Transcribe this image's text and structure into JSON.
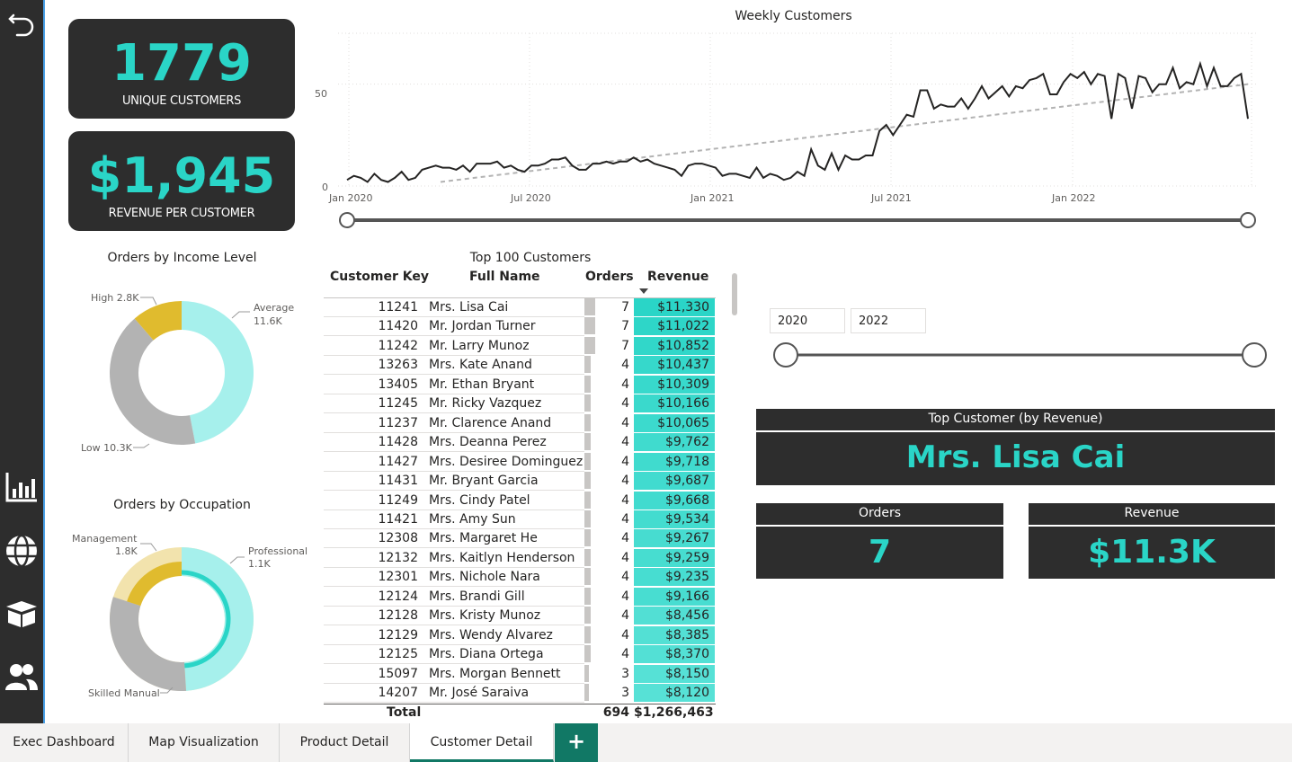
{
  "sidebar": {
    "back_icon": "undo-arrow-icon",
    "items": [
      {
        "icon": "bar-chart-icon"
      },
      {
        "icon": "globe-icon"
      },
      {
        "icon": "box-icon"
      },
      {
        "icon": "users-icon"
      }
    ]
  },
  "kpis": {
    "unique_customers": {
      "value": "1779",
      "label": "UNIQUE CUSTOMERS"
    },
    "revenue_per_customer": {
      "value": "$1,945",
      "label": "REVENUE PER CUSTOMER"
    }
  },
  "weekly_chart": {
    "title": "Weekly Customers",
    "y_ticks": [
      "50",
      "0"
    ],
    "x_ticks": [
      "Jan 2020",
      "Jul 2020",
      "Jan 2021",
      "Jul 2021",
      "Jan 2022"
    ]
  },
  "chart_data": [
    {
      "type": "line",
      "title": "Weekly Customers",
      "xlabel": "",
      "ylabel": "",
      "ylim": [
        0,
        75
      ],
      "x_ticks": [
        "Jan 2020",
        "Jul 2020",
        "Jan 2021",
        "Jul 2021",
        "Jan 2022"
      ],
      "x_start": "2020-01-01",
      "x_end": "2022-06-30",
      "series": [
        {
          "values": [
            3,
            5,
            4,
            2,
            6,
            3,
            2,
            4,
            7,
            3,
            4,
            8,
            9,
            10,
            9,
            9,
            8,
            10,
            7,
            11,
            11,
            11,
            12,
            9,
            10,
            8,
            7,
            10,
            10,
            11,
            13,
            13,
            14,
            10,
            8,
            8,
            11,
            11,
            12,
            11,
            12,
            12,
            14,
            12,
            13,
            11,
            10,
            9,
            8,
            5,
            10,
            11,
            11,
            10,
            9,
            5,
            6,
            6,
            5,
            4,
            9,
            4,
            6,
            5,
            3,
            4,
            7,
            5,
            18,
            10,
            8,
            16,
            8,
            15,
            13,
            13,
            15,
            15,
            27,
            30,
            25,
            30,
            35,
            34,
            47,
            47,
            38,
            40,
            39,
            39,
            43,
            38,
            43,
            49,
            43,
            46,
            49,
            44,
            49,
            48,
            52,
            53,
            55,
            45,
            45,
            51,
            55,
            53,
            56,
            50,
            55,
            54,
            33,
            55,
            53,
            38,
            54,
            53,
            46,
            50,
            50,
            58,
            48,
            51,
            50,
            60,
            49,
            58,
            49,
            49,
            53,
            55,
            33
          ]
        },
        {
          "name": "trend",
          "values_from_to": [
            2,
            50
          ]
        }
      ]
    },
    {
      "type": "pie",
      "title": "Orders by Income Level",
      "categories": [
        "Average",
        "Low",
        "High"
      ],
      "values": [
        11600,
        10300,
        2800
      ],
      "labels": [
        "Average 11.6K",
        "Low 10.3K",
        "High 2.8K"
      ]
    },
    {
      "type": "pie",
      "title": "Orders by Occupation",
      "categories": [
        "Professional",
        "Skilled Manual",
        "Management"
      ],
      "values": [
        49,
        31,
        20
      ],
      "labels": [
        "Professional 1.1K",
        "Skilled Manual",
        "Management 1.8K"
      ]
    }
  ],
  "income_chart": {
    "title": "Orders by Income Level",
    "labels": {
      "high": "High 2.8K",
      "average_1": "Average",
      "average_2": "11.6K",
      "low": "Low 10.3K"
    }
  },
  "occupation_chart": {
    "title": "Orders by Occupation",
    "labels": {
      "management_1": "Management",
      "management_2": "1.8K",
      "professional_1": "Professional",
      "professional_2": "1.1K",
      "skilled": "Skilled Manual"
    }
  },
  "table": {
    "title": "Top 100 Customers",
    "columns": [
      "Customer Key",
      "Full Name",
      "Orders",
      "Revenue"
    ],
    "rows": [
      {
        "key": "11241",
        "name": "Mrs. Lisa Cai",
        "orders": "7",
        "revenue": "$11,330",
        "v": 11330
      },
      {
        "key": "11420",
        "name": "Mr. Jordan Turner",
        "orders": "7",
        "revenue": "$11,022",
        "v": 11022
      },
      {
        "key": "11242",
        "name": "Mr. Larry Munoz",
        "orders": "7",
        "revenue": "$10,852",
        "v": 10852
      },
      {
        "key": "13263",
        "name": "Mrs. Kate Anand",
        "orders": "4",
        "revenue": "$10,437",
        "v": 10437
      },
      {
        "key": "13405",
        "name": "Mr. Ethan Bryant",
        "orders": "4",
        "revenue": "$10,309",
        "v": 10309
      },
      {
        "key": "11245",
        "name": "Mr. Ricky Vazquez",
        "orders": "4",
        "revenue": "$10,166",
        "v": 10166
      },
      {
        "key": "11237",
        "name": "Mr. Clarence Anand",
        "orders": "4",
        "revenue": "$10,065",
        "v": 10065
      },
      {
        "key": "11428",
        "name": "Mrs. Deanna Perez",
        "orders": "4",
        "revenue": "$9,762",
        "v": 9762
      },
      {
        "key": "11427",
        "name": "Mrs. Desiree Dominguez",
        "orders": "4",
        "revenue": "$9,718",
        "v": 9718
      },
      {
        "key": "11431",
        "name": "Mr. Bryant Garcia",
        "orders": "4",
        "revenue": "$9,687",
        "v": 9687
      },
      {
        "key": "11249",
        "name": "Mrs. Cindy Patel",
        "orders": "4",
        "revenue": "$9,668",
        "v": 9668
      },
      {
        "key": "11421",
        "name": "Mrs. Amy Sun",
        "orders": "4",
        "revenue": "$9,534",
        "v": 9534
      },
      {
        "key": "12308",
        "name": "Mrs. Margaret He",
        "orders": "4",
        "revenue": "$9,267",
        "v": 9267
      },
      {
        "key": "12132",
        "name": "Mrs. Kaitlyn Henderson",
        "orders": "4",
        "revenue": "$9,259",
        "v": 9259
      },
      {
        "key": "12301",
        "name": "Mrs. Nichole Nara",
        "orders": "4",
        "revenue": "$9,235",
        "v": 9235
      },
      {
        "key": "12124",
        "name": "Mrs. Brandi Gill",
        "orders": "4",
        "revenue": "$9,166",
        "v": 9166
      },
      {
        "key": "12128",
        "name": "Mrs. Kristy Munoz",
        "orders": "4",
        "revenue": "$8,456",
        "v": 8456
      },
      {
        "key": "12129",
        "name": "Mrs. Wendy Alvarez",
        "orders": "4",
        "revenue": "$8,385",
        "v": 8385
      },
      {
        "key": "12125",
        "name": "Mrs. Diana Ortega",
        "orders": "4",
        "revenue": "$8,370",
        "v": 8370
      },
      {
        "key": "15097",
        "name": "Mrs. Morgan Bennett",
        "orders": "3",
        "revenue": "$8,150",
        "v": 8150
      },
      {
        "key": "14207",
        "name": "Mr. José Saraiva",
        "orders": "3",
        "revenue": "$8,120",
        "v": 8120
      }
    ],
    "total": {
      "label": "Total",
      "orders": "694",
      "revenue": "$1,266,463"
    }
  },
  "date_slicer": {
    "start": "2020",
    "end": "2022"
  },
  "top_customer": {
    "title": "Top Customer (by Revenue)",
    "name": "Mrs. Lisa Cai"
  },
  "top_orders": {
    "title": "Orders",
    "value": "7"
  },
  "top_revenue": {
    "title": "Revenue",
    "value": "$11.3K"
  },
  "tabs": [
    {
      "label": "Exec Dashboard"
    },
    {
      "label": "Map Visualization"
    },
    {
      "label": "Product Detail"
    },
    {
      "label": "Customer Detail"
    }
  ],
  "add_tab_label": "+",
  "colors": {
    "accent": "#2ad5c7",
    "dark": "#2d2d2d",
    "grey": "#b3b3b3",
    "gold": "#e0bb2e",
    "light_teal": "#a6f0ec",
    "light_gold": "#f2e3ad"
  }
}
